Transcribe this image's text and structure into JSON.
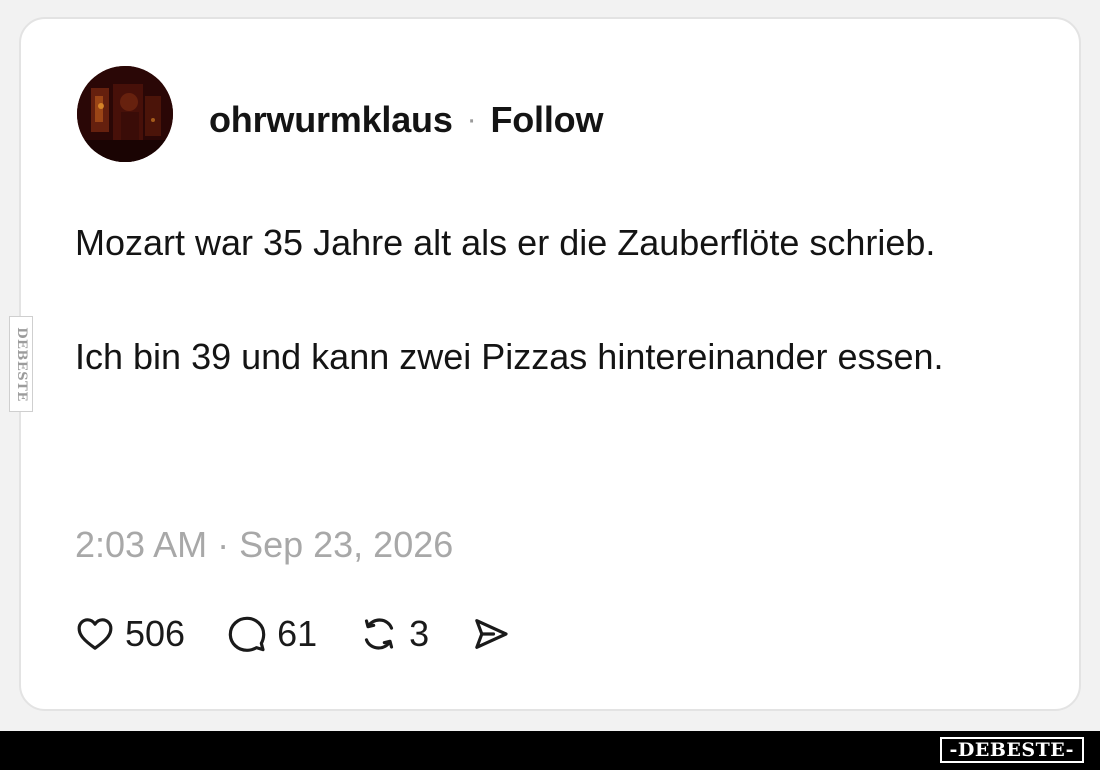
{
  "post": {
    "username": "ohrwurmklaus",
    "separator": "·",
    "follow_label": "Follow",
    "text_paragraph_1": "Mozart war 35 Jahre alt als er die Zauberflöte schrieb.",
    "text_paragraph_2": "Ich bin 39 und kann zwei Pizzas hintereinander essen.",
    "timestamp": "2:03 AM · Sep 23, 2026",
    "actions": {
      "likes": "506",
      "comments": "61",
      "reposts": "3"
    },
    "icons": {
      "like": "heart-icon",
      "comment": "speech-bubble-icon",
      "repost": "repost-icon",
      "share": "send-icon"
    }
  },
  "watermark": {
    "side_label": "DEBESTE",
    "footer_logo": "-DEBESTE-"
  },
  "colors": {
    "page_background": "#f2f2f2",
    "card_background": "#ffffff",
    "text": "#141414",
    "muted_text": "#a8a8a8",
    "footer_bar": "#000000"
  }
}
